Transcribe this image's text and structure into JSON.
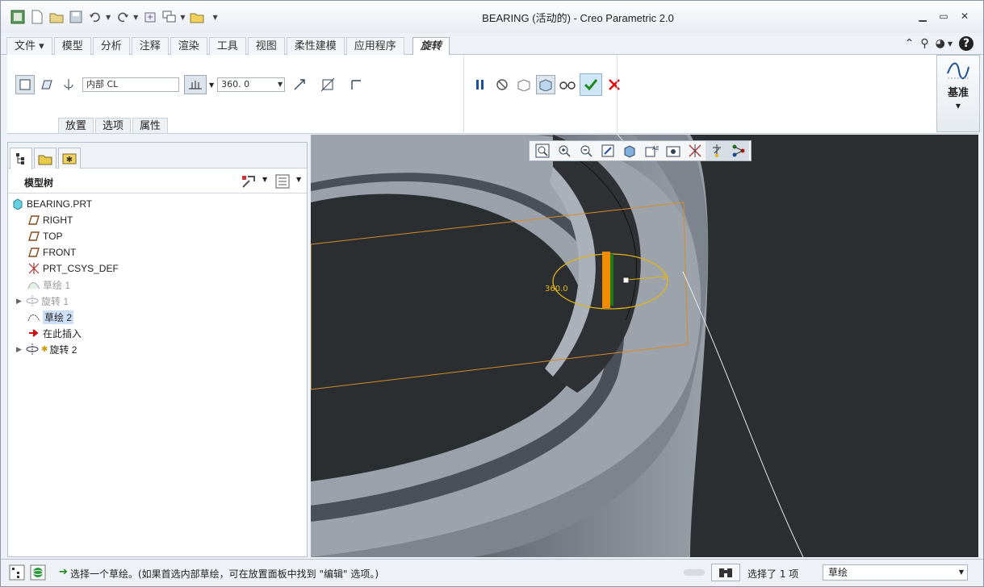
{
  "window": {
    "title": "BEARING (活动的) - Creo Parametric 2.0",
    "controls": [
      "minimize-icon",
      "restore-icon",
      "close-icon"
    ]
  },
  "quick_access": {
    "icons": [
      "new-icon",
      "open-icon",
      "save-icon",
      "undo-icon",
      "redo-icon",
      "regenerate-icon",
      "windows-icon",
      "close-window-icon",
      "customize-icon"
    ]
  },
  "menu": {
    "tabs": [
      {
        "label": "文件",
        "dropdown": true
      },
      {
        "label": "模型"
      },
      {
        "label": "分析"
      },
      {
        "label": "注释"
      },
      {
        "label": "渲染"
      },
      {
        "label": "工具"
      },
      {
        "label": "视图"
      },
      {
        "label": "柔性建模"
      },
      {
        "label": "应用程序"
      },
      {
        "label": "旋转",
        "active": true
      }
    ]
  },
  "ribbon": {
    "sketch_field": "内部 CL",
    "angle_value": "360. 0",
    "subtabs": [
      "放置",
      "选项",
      "属性"
    ],
    "datum_label": "基准"
  },
  "model_tree": {
    "header": "模型树",
    "items": [
      {
        "label": "BEARING.PRT",
        "icon": "part-icon"
      },
      {
        "label": "RIGHT",
        "icon": "datum-plane-icon"
      },
      {
        "label": "TOP",
        "icon": "datum-plane-icon"
      },
      {
        "label": "FRONT",
        "icon": "datum-plane-icon"
      },
      {
        "label": "PRT_CSYS_DEF",
        "icon": "csys-icon"
      },
      {
        "label": "草绘 1",
        "icon": "sketch-icon"
      },
      {
        "label": "旋转 1",
        "icon": "revolve-icon"
      },
      {
        "label": "草绘 2",
        "icon": "sketch-icon"
      },
      {
        "label": "在此插入",
        "icon": "insert-arrow-icon"
      },
      {
        "label": "旋转 2",
        "icon": "revolve-icon"
      }
    ]
  },
  "viewport": {
    "angle_annotation": "360.0"
  },
  "status": {
    "message": "选择一个草绘。(如果首选内部草绘，可在放置面板中找到 \"编辑\" 选项。)",
    "selection": "选择了 1 项",
    "filter": "草绘"
  }
}
